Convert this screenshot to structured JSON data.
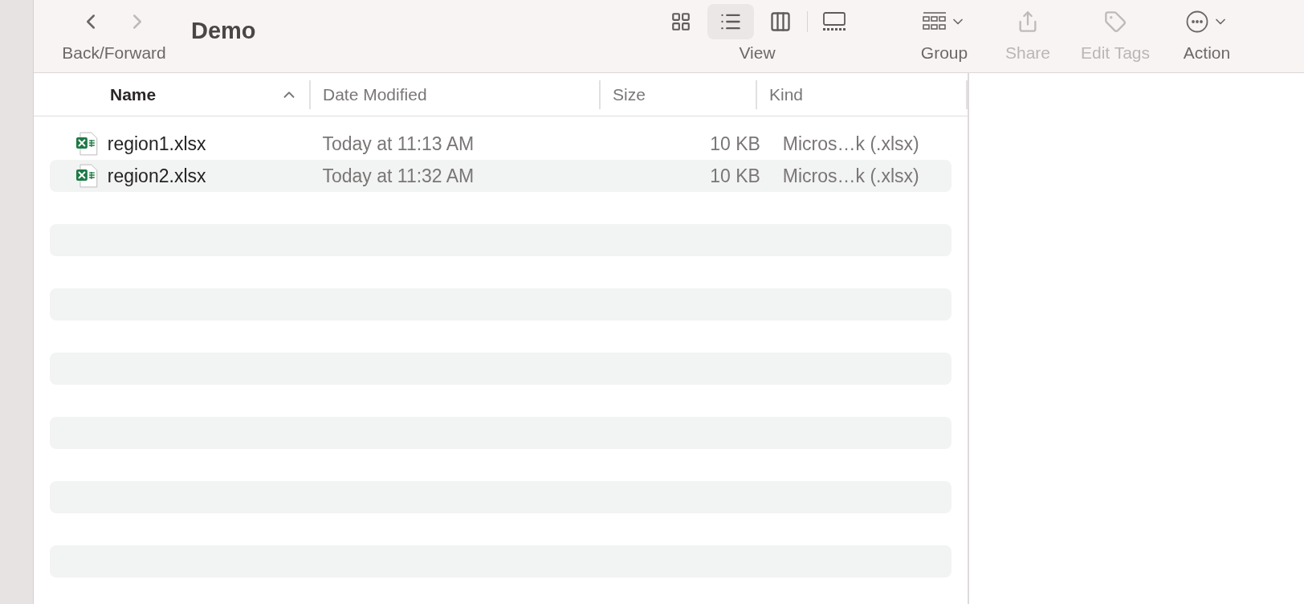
{
  "toolbar": {
    "nav": {
      "label": "Back/Forward",
      "back_disabled": false,
      "forward_disabled": true
    },
    "title": "Demo",
    "view": {
      "label": "View",
      "modes": [
        {
          "kind": "icons",
          "selected": false
        },
        {
          "kind": "list",
          "selected": true
        },
        {
          "kind": "columns",
          "selected": false
        },
        {
          "kind": "gallery",
          "selected": false
        }
      ]
    },
    "actions": [
      {
        "kind": "group",
        "label": "Group",
        "disabled": false
      },
      {
        "kind": "share",
        "label": "Share",
        "disabled": true
      },
      {
        "kind": "tags",
        "label": "Edit Tags",
        "disabled": true
      },
      {
        "kind": "action",
        "label": "Action",
        "disabled": false
      }
    ]
  },
  "table": {
    "columns": [
      {
        "label": "Name",
        "sorted": true
      },
      {
        "label": "Date Modified",
        "sorted": false
      },
      {
        "label": "Size",
        "sorted": false
      },
      {
        "label": "Kind",
        "sorted": false
      }
    ],
    "rows": [
      {
        "name": "region1.xlsx",
        "date": "Today at 11:13 AM",
        "size": "10 KB",
        "kind": "Micros…k (.xlsx)"
      },
      {
        "name": "region2.xlsx",
        "date": "Today at 11:32 AM",
        "size": "10 KB",
        "kind": "Micros…k (.xlsx)"
      }
    ]
  }
}
